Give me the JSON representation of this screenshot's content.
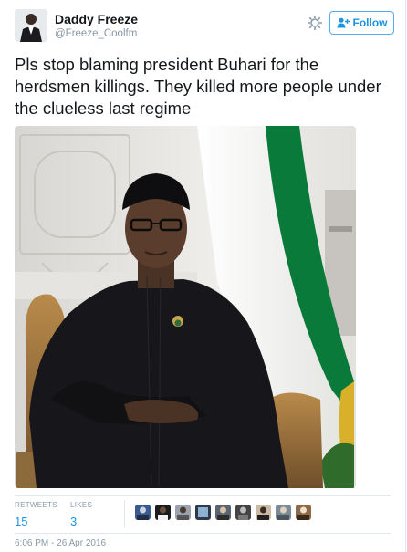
{
  "author": {
    "display_name": "Daddy Freeze",
    "handle": "@Freeze_Coolfm",
    "avatar_icon": "user-avatar"
  },
  "actions": {
    "settings_icon": "gear-icon",
    "follow_label": "Follow",
    "follow_icon": "add-user-icon"
  },
  "tweet": {
    "text": "Pls stop blaming president Buhari for the herdsmen killings. They killed more people under the clueless last regime",
    "media_icon": "photo"
  },
  "stats": {
    "retweets_label": "RETWEETS",
    "retweets_count": "15",
    "likes_label": "LIKES",
    "likes_count": "3"
  },
  "timestamp": "6:06 PM - 26 Apr 2016",
  "colors": {
    "accent": "#1b95e0",
    "border": "#e1e8ed",
    "muted": "#8899a6",
    "flag_green": "#0a7a3a",
    "flag_white": "#f4f4f2"
  }
}
